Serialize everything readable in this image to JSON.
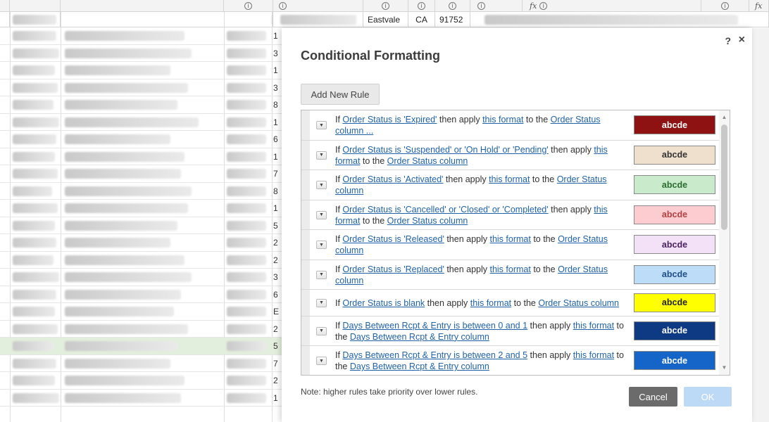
{
  "sheet": {
    "top_row": {
      "city": "Eastvale",
      "state": "CA",
      "zip": "91752"
    },
    "col_digits": [
      "1",
      "3",
      "1",
      "3",
      "8",
      "1",
      "6",
      "1",
      "7",
      "8",
      "1",
      "5",
      "2",
      "2",
      "3",
      "6",
      "E",
      "2",
      "5",
      "7",
      "2",
      "1"
    ]
  },
  "dialog": {
    "title": "Conditional Formatting",
    "help_label": "?",
    "close_label": "×",
    "add_rule_label": "Add New Rule",
    "note": "Note: higher rules take priority over lower rules.",
    "cancel_label": "Cancel",
    "ok_label": "OK",
    "rules": [
      {
        "p1": "If ",
        "condition": "Order Status is 'Expired'",
        "p2": " then apply ",
        "fmt": "this format",
        "p3": " to the ",
        "target": "Order Status column ...",
        "p4": "",
        "swatch": {
          "text": "abcde",
          "bg": "#8e1212",
          "fg": "#ffffff"
        }
      },
      {
        "p1": "If ",
        "condition": "Order Status is 'Suspended' or 'On Hold' or 'Pending'",
        "p2": " then apply ",
        "fmt": "this format",
        "p3": " to the ",
        "target": "Order Status column",
        "p4": "",
        "swatch": {
          "text": "abcde",
          "bg": "#efdfcd",
          "fg": "#333333"
        }
      },
      {
        "p1": "If ",
        "condition": "Order Status is 'Activated'",
        "p2": " then apply ",
        "fmt": "this format",
        "p3": " to the ",
        "target": "Order Status column",
        "p4": "",
        "swatch": {
          "text": "abcde",
          "bg": "#c9ebcb",
          "fg": "#2a6b2e"
        }
      },
      {
        "p1": "If ",
        "condition": "Order Status is 'Cancelled' or 'Closed' or 'Completed'",
        "p2": " then apply ",
        "fmt": "this format",
        "p3": " to the ",
        "target": "Order Status column",
        "p4": "",
        "swatch": {
          "text": "abcde",
          "bg": "#fcccd0",
          "fg": "#b0413f"
        }
      },
      {
        "p1": "If ",
        "condition": "Order Status is 'Released'",
        "p2": " then apply ",
        "fmt": "this format",
        "p3": " to the ",
        "target": "Order Status column",
        "p4": "",
        "swatch": {
          "text": "abcde",
          "bg": "#f2e1f7",
          "fg": "#4a2060"
        }
      },
      {
        "p1": "If ",
        "condition": "Order Status is 'Replaced'",
        "p2": " then apply ",
        "fmt": "this format",
        "p3": " to the ",
        "target": "Order Status column",
        "p4": "",
        "swatch": {
          "text": "abcde",
          "bg": "#bcdcf7",
          "fg": "#1f4f86"
        }
      },
      {
        "p1": "If ",
        "condition": "Order Status is blank",
        "p2": " then apply ",
        "fmt": "this format",
        "p3": " to the ",
        "target": "Order Status column",
        "p4": "",
        "swatch": {
          "text": "abcde",
          "bg": "#ffff00",
          "fg": "#222222"
        }
      },
      {
        "p1": "If ",
        "condition": "Days Between Rcpt & Entry is between 0 and 1",
        "p2": " then apply ",
        "fmt": "this format",
        "p3": " to the ",
        "target": "Days Between Rcpt & Entry column",
        "p4": "",
        "swatch": {
          "text": "abcde",
          "bg": "#0e3a84",
          "fg": "#ffffff"
        }
      },
      {
        "p1": "If ",
        "condition": "Days Between Rcpt & Entry is between 2 and 5",
        "p2": " then apply ",
        "fmt": "this format",
        "p3": " to the ",
        "target": "Days Between Rcpt & Entry column",
        "p4": "",
        "swatch": {
          "text": "abcde",
          "bg": "#1565c8",
          "fg": "#ffffff"
        }
      }
    ]
  },
  "colors": {
    "link": "#1f62a8",
    "ok_disabled": "#bcd9f5",
    "cancel": "#6b6b6b"
  }
}
